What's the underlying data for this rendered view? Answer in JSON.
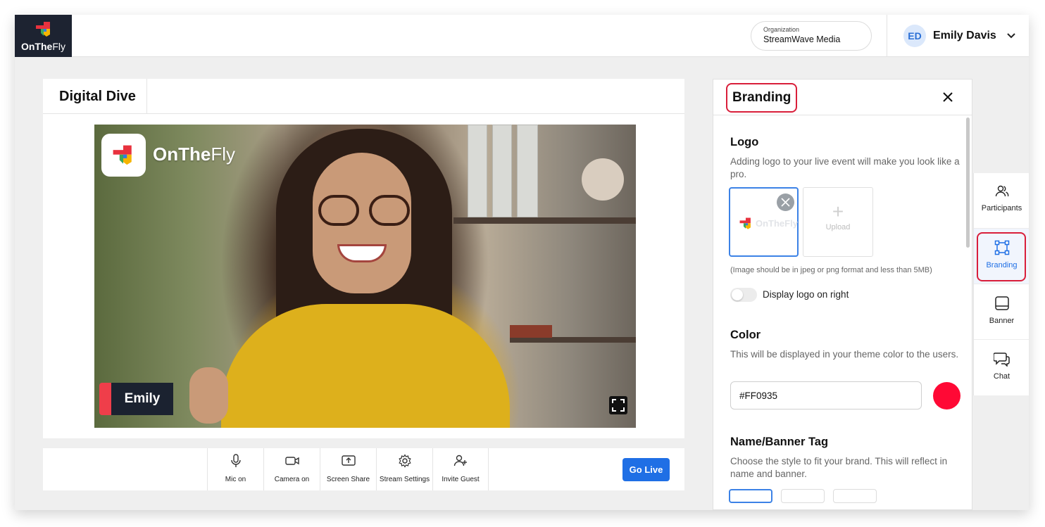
{
  "app": {
    "logo_text_bold": "OnThe",
    "logo_text_light": "Fly"
  },
  "header": {
    "organization_label": "Organization",
    "organization_name": "StreamWave Media",
    "user_initials": "ED",
    "user_name": "Emily Davis"
  },
  "stage": {
    "title": "Digital Dive",
    "overlay_logo_bold": "OnThe",
    "overlay_logo_light": "Fly",
    "participant_name": "Emily"
  },
  "controls": [
    {
      "label": "Mic on",
      "icon": "mic-icon"
    },
    {
      "label": "Camera on",
      "icon": "camera-icon"
    },
    {
      "label": "Screen Share",
      "icon": "screen-share-icon"
    },
    {
      "label": "Stream Settings",
      "icon": "gear-icon"
    },
    {
      "label": "Invite Guest",
      "icon": "add-user-icon"
    }
  ],
  "go_live_label": "Go Live",
  "branding": {
    "title": "Branding",
    "logo_section": {
      "title": "Logo",
      "description": "Adding logo to your live event will make you look like a pro.",
      "thumb_text": "OnTheFly",
      "upload_label": "Upload",
      "hint": "(Image should be in jpeg or png format and less than 5MB)",
      "toggle_label": "Display logo on right",
      "toggle_on": false
    },
    "color_section": {
      "title": "Color",
      "description": "This will be displayed in your theme color to the users.",
      "value": "#FF0935"
    },
    "tag_section": {
      "title": "Name/Banner Tag",
      "description": "Choose the style to fit your brand. This will reflect in name and banner."
    }
  },
  "rail": [
    {
      "label": "Participants",
      "icon": "participants-icon",
      "active": false
    },
    {
      "label": "Branding",
      "icon": "branding-icon",
      "active": true
    },
    {
      "label": "Banner",
      "icon": "banner-icon",
      "active": false
    },
    {
      "label": "Chat",
      "icon": "chat-icon",
      "active": false
    }
  ],
  "colors": {
    "accent_blue": "#1f6fe5",
    "brand_red": "#FF0935",
    "highlight_red": "#d91e3a",
    "logo_navy": "#1d2331"
  }
}
